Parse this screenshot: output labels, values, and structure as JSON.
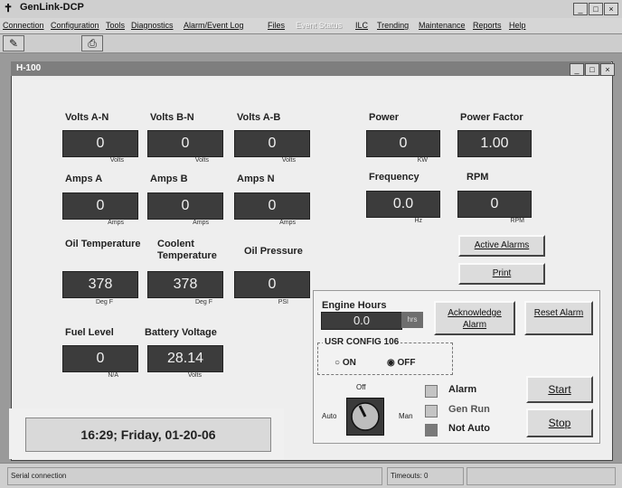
{
  "app": {
    "title": "GenLink-DCP"
  },
  "menu": [
    "Connection",
    "Configuration",
    "Tools",
    "Diagnostics",
    "Alarm/Event Log",
    "Files",
    "Event Status",
    "ILC",
    "Trending",
    "Maintenance",
    "Reports",
    "Help"
  ],
  "menu_disabled": [
    "Event Status"
  ],
  "child": {
    "title": "H-100"
  },
  "meters": {
    "volts_an": {
      "label": "Volts A-N",
      "value": "0",
      "unit": "Volts"
    },
    "volts_bn": {
      "label": "Volts B-N",
      "value": "0",
      "unit": "Volts"
    },
    "volts_ab": {
      "label": "Volts A-B",
      "value": "0",
      "unit": "Volts"
    },
    "power": {
      "label": "Power",
      "value": "0",
      "unit": "KW"
    },
    "power_factor": {
      "label": "Power Factor",
      "value": "1.00",
      "unit": ""
    },
    "amps_a": {
      "label": "Amps A",
      "value": "0",
      "unit": "Amps"
    },
    "amps_b": {
      "label": "Amps B",
      "value": "0",
      "unit": "Amps"
    },
    "amps_n": {
      "label": "Amps N",
      "value": "0",
      "unit": "Amps"
    },
    "frequency": {
      "label": "Frequency",
      "value": "0.0",
      "unit": "Hz"
    },
    "rpm": {
      "label": "RPM",
      "value": "0",
      "unit": "RPM"
    },
    "oil_temp": {
      "label": "Oil Temperature",
      "value": "378",
      "unit": "Deg F"
    },
    "coolant_temp": {
      "label": "Coolent Temperature",
      "value": "378",
      "unit": "Deg F"
    },
    "oil_pressure": {
      "label": "Oil Pressure",
      "value": "0",
      "unit": "PSI"
    },
    "fuel_level": {
      "label": "Fuel Level",
      "value": "0",
      "unit": "N/A"
    },
    "battery_voltage": {
      "label": "Battery Voltage",
      "value": "28.14",
      "unit": "Volts"
    }
  },
  "buttons": {
    "active_alarms": "Active Alarms",
    "print": "Print",
    "acknowledge_alarm": "Acknowledge Alarm",
    "reset_alarm": "Reset Alarm",
    "start": "Start",
    "stop": "Stop"
  },
  "engine_hours": {
    "label": "Engine Hours",
    "value": "0.0",
    "unit": "hrs"
  },
  "usr_config": {
    "label": "USR CONFIG 106",
    "on": "ON",
    "off": "OFF",
    "selected": "OFF"
  },
  "mode_switch": {
    "off": "Off",
    "auto": "Auto",
    "man": "Man"
  },
  "indicators": [
    {
      "label": "Alarm",
      "color": "#c4c4c4"
    },
    {
      "label": "Gen Run",
      "color": "#c4c4c4"
    },
    {
      "label": "Not Auto",
      "color": "#7a7a7a"
    }
  ],
  "clock": "16:29; Friday, 01-20-06",
  "status": {
    "connection": "Serial connection",
    "timeouts": "Timeouts: 0"
  }
}
